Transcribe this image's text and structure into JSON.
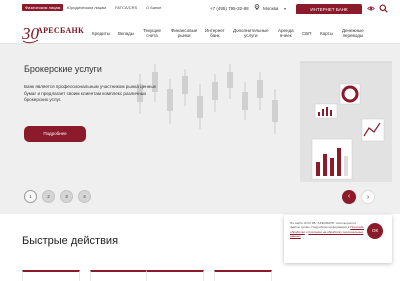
{
  "topbar": {
    "links": [
      "Физическим лицам",
      "Юридическим лицам",
      "FATCA/CRS",
      "О Банке"
    ],
    "phone": "+7 (495) 795-32-88",
    "city": "Москва",
    "internet_bank": "ИНТЕРНЕТ БАНК"
  },
  "header": {
    "logo": "АРЕСБАНК",
    "logo_mark": "30"
  },
  "nav": {
    "items": [
      "Кредиты",
      "Вклады",
      "Текущие\nсчета",
      "Финансовые\nрынки",
      "Интернет\nбанк",
      "Дополнительные\nуслуги",
      "Аренда\nячеек",
      "СБП",
      "Карты",
      "Денежные\nпереводы"
    ]
  },
  "hero": {
    "title": "Брокерские услуги",
    "body": "Банк является профессиональным участником рынка ценных бумаг и предлагает своим клиентам комплекс различных брокерских услуг.",
    "button": "Подробнее",
    "pages": [
      "1",
      "2",
      "3",
      "4"
    ],
    "active_page": 1,
    "prev": "‹",
    "next": "›"
  },
  "quick_actions": {
    "title": "Быстрые действия"
  },
  "cookie": {
    "text": "На сайте ООО КБ \"АРЕСБАНК\" используются файлы cookie. Подробная информация в",
    "link1": "Политике обработки",
    "middle": "и",
    "link2": "Согласии на обработку персональных данных",
    "ok": "ОК"
  },
  "colors": {
    "brand": "#8b1a2b",
    "hero_bg": "#efefef"
  }
}
